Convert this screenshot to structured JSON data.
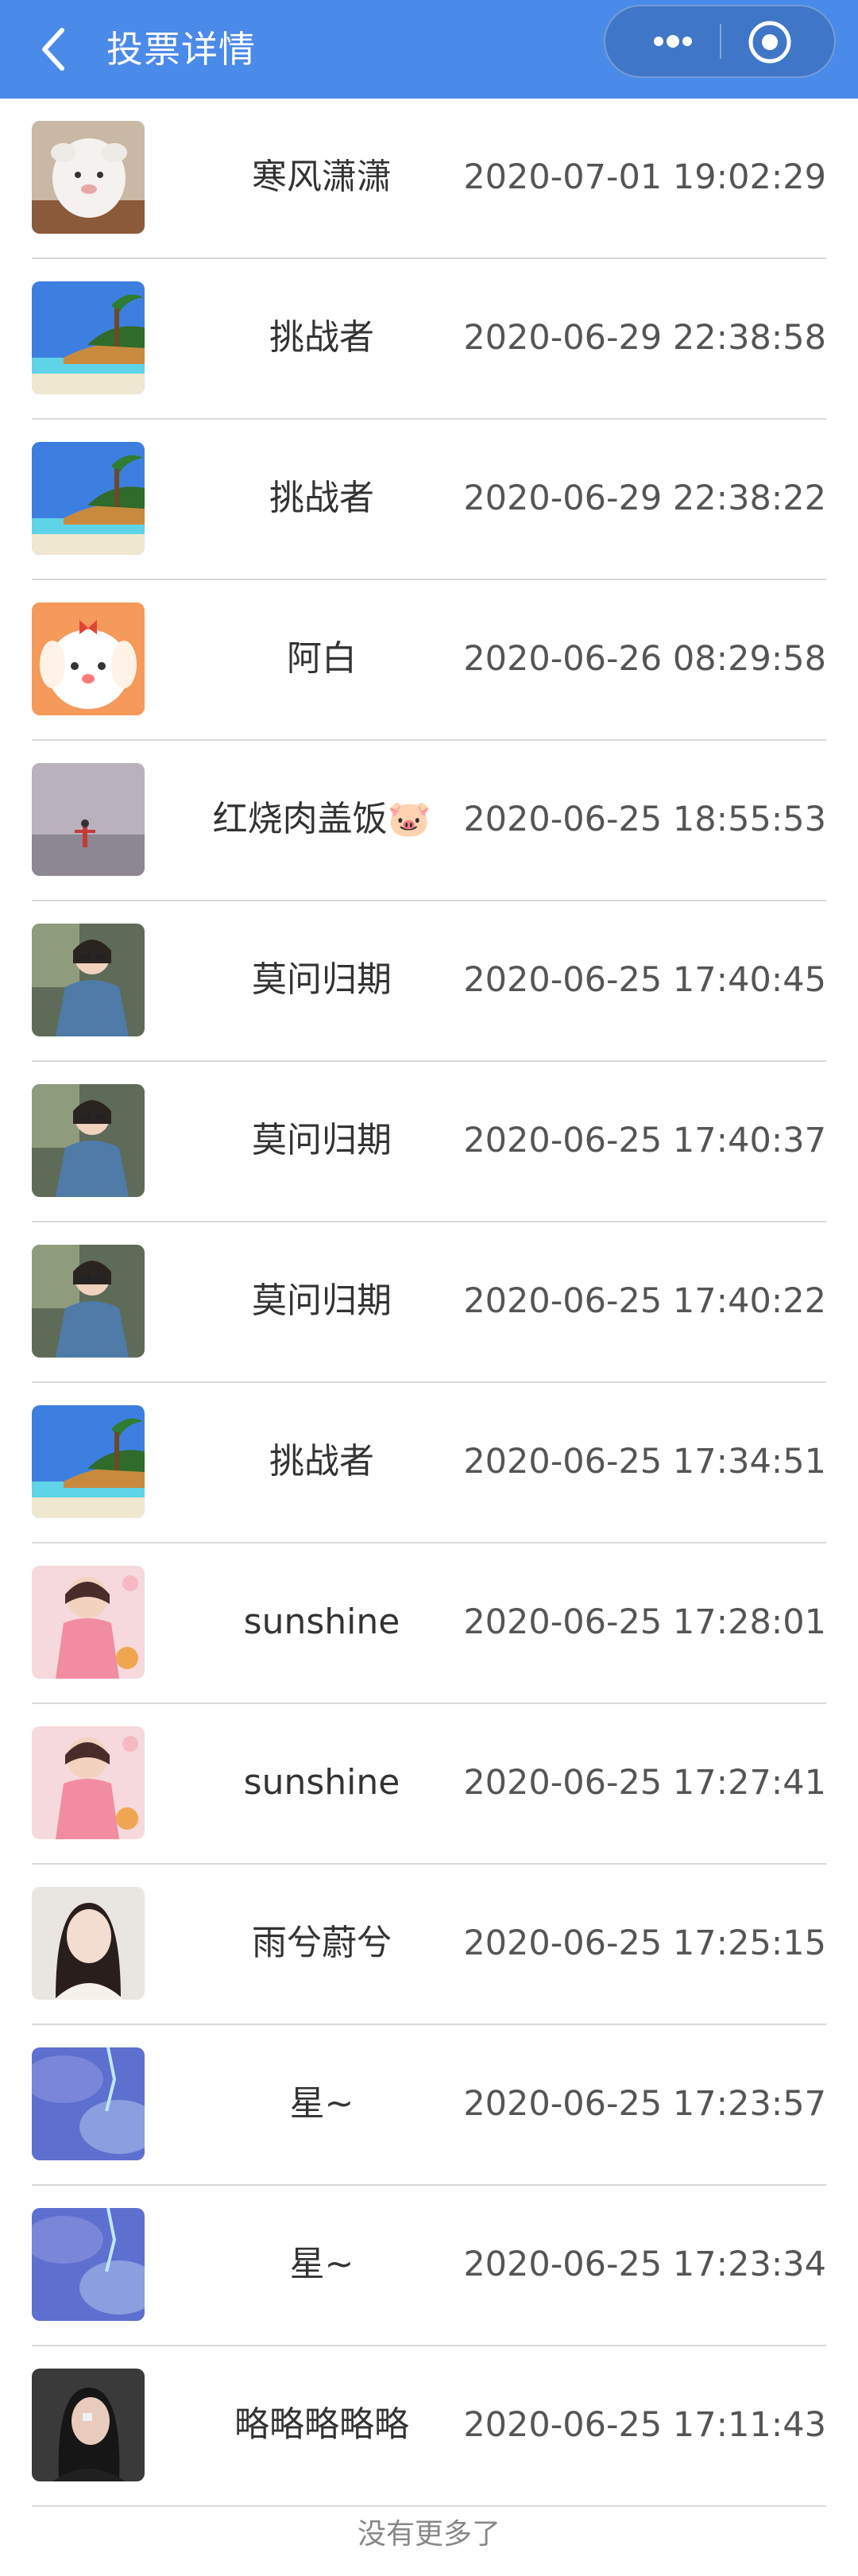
{
  "header": {
    "title": "投票详情",
    "background": "#4a8ae8"
  },
  "rows": [
    {
      "name": "寒风潇潇",
      "time": "2020-07-01 19:02:29",
      "avatar": "white-plush-avatar"
    },
    {
      "name": "挑战者",
      "time": "2020-06-29 22:38:58",
      "avatar": "beach-island-avatar"
    },
    {
      "name": "挑战者",
      "time": "2020-06-29 22:38:22",
      "avatar": "beach-island-avatar"
    },
    {
      "name": "阿白",
      "time": "2020-06-26 08:29:58",
      "avatar": "cartoon-puppy-avatar"
    },
    {
      "name": "红烧肉盖饭🐷",
      "time": "2020-06-25 18:55:53",
      "avatar": "foggy-field-avatar"
    },
    {
      "name": "莫问归期",
      "time": "2020-06-25 17:40:45",
      "avatar": "girl-sunglasses-avatar"
    },
    {
      "name": "莫问归期",
      "time": "2020-06-25 17:40:37",
      "avatar": "girl-sunglasses-avatar"
    },
    {
      "name": "莫问归期",
      "time": "2020-06-25 17:40:22",
      "avatar": "girl-sunglasses-avatar"
    },
    {
      "name": "挑战者",
      "time": "2020-06-25 17:34:51",
      "avatar": "beach-island-avatar"
    },
    {
      "name": "sunshine",
      "time": "2020-06-25 17:28:01",
      "avatar": "cartoon-girl-pink-avatar"
    },
    {
      "name": "sunshine",
      "time": "2020-06-25 17:27:41",
      "avatar": "cartoon-girl-pink-avatar"
    },
    {
      "name": "雨兮蔚兮",
      "time": "2020-06-25 17:25:15",
      "avatar": "woman-portrait-avatar"
    },
    {
      "name": "星~",
      "time": "2020-06-25 17:23:57",
      "avatar": "blue-sky-avatar"
    },
    {
      "name": "星~",
      "time": "2020-06-25 17:23:34",
      "avatar": "blue-sky-avatar"
    },
    {
      "name": "略略略略略",
      "time": "2020-06-25 17:11:43",
      "avatar": "woman-dark-avatar"
    }
  ],
  "footer": {
    "text": "没有更多了"
  }
}
